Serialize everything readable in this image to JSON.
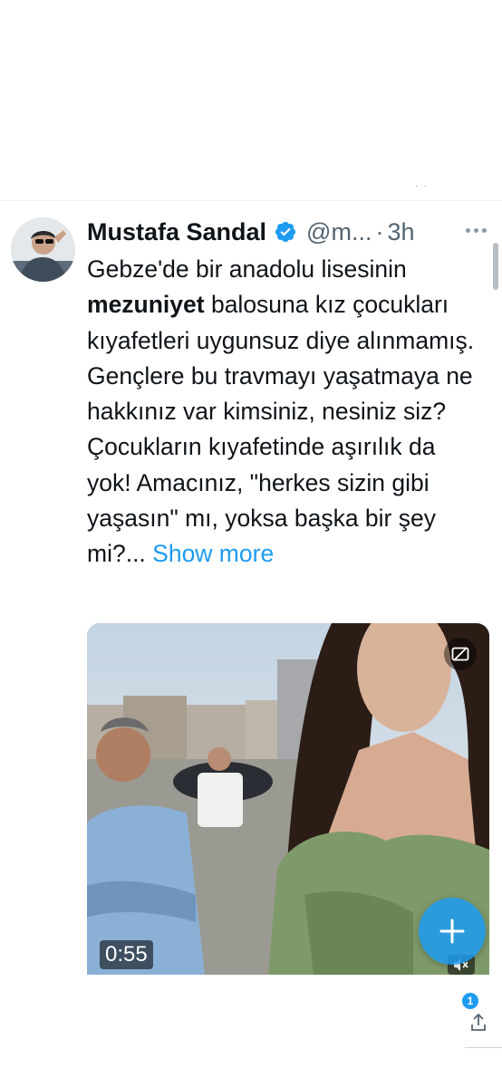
{
  "tweet": {
    "author_name": "Mustafa Sandal",
    "handle": "@m...",
    "separator": "·",
    "time": "3h",
    "text_line1": "Gebze'de bir anadolu lisesinin",
    "text_bold": "mezuniyet",
    "text_after_bold": " balosuna kız çocukları kıyafetleri uygunsuz diye alınmamış. Gençlere bu travmayı yaşatmaya ne hakkınız var kimsiniz, nesiniz siz? Çocukların kıyafetinde aşırılık da yok! Amacınız, \"herkes sizin gibi yaşasın\" mı,  yoksa başka bir şey mi?... ",
    "show_more": "Show more"
  },
  "media": {
    "duration": "0:55"
  },
  "notifications": {
    "badge_count": "1"
  },
  "colors": {
    "accent": "#1d9bf0",
    "text": "#0f1419",
    "secondary": "#536471"
  },
  "icons": {
    "verified": "verified-badge-icon",
    "more": "more-horizontal-icon",
    "fab": "plus-icon",
    "mute": "mute-icon",
    "captions": "no-captions-icon",
    "share": "share-icon"
  }
}
